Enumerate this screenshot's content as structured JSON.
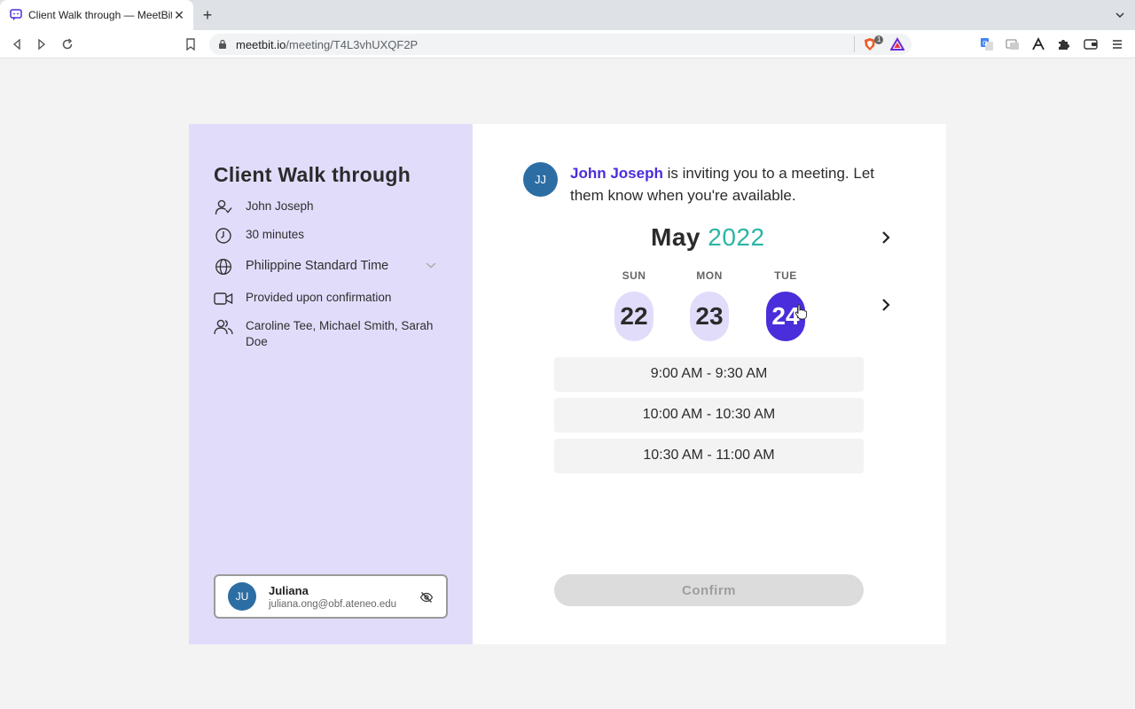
{
  "browser": {
    "tab_title": "Client Walk through — MeetBit",
    "url_domain": "meetbit.io",
    "url_path": "/meeting/T4L3vhUXQF2P",
    "brave_count": "1"
  },
  "meeting": {
    "title": "Client Walk through",
    "host": "John Joseph",
    "duration": "30 minutes",
    "timezone": "Philippine Standard Time",
    "location": "Provided upon confirmation",
    "attendees": "Caroline Tee, Michael Smith, Sarah Doe"
  },
  "user": {
    "initials": "JU",
    "name": "Juliana",
    "email": "juliana.ong@obf.ateneo.edu"
  },
  "invite": {
    "host_initials": "JJ",
    "host_name": "John Joseph",
    "message": " is inviting you to a meeting. Let them know when you're available."
  },
  "calendar": {
    "month": "May",
    "year": "2022",
    "days": [
      {
        "dow": "SUN",
        "date": "22",
        "selected": false
      },
      {
        "dow": "MON",
        "date": "23",
        "selected": false
      },
      {
        "dow": "TUE",
        "date": "24",
        "selected": true
      }
    ]
  },
  "slots": [
    "9:00 AM - 9:30 AM",
    "10:00 AM - 10:30 AM",
    "10:30 AM - 11:00 AM"
  ],
  "confirm_label": "Confirm",
  "colors": {
    "accent": "#4a2ddb",
    "panel": "#e2dcfb",
    "year": "#2bb5a6",
    "avatar": "#2c6ea4"
  }
}
